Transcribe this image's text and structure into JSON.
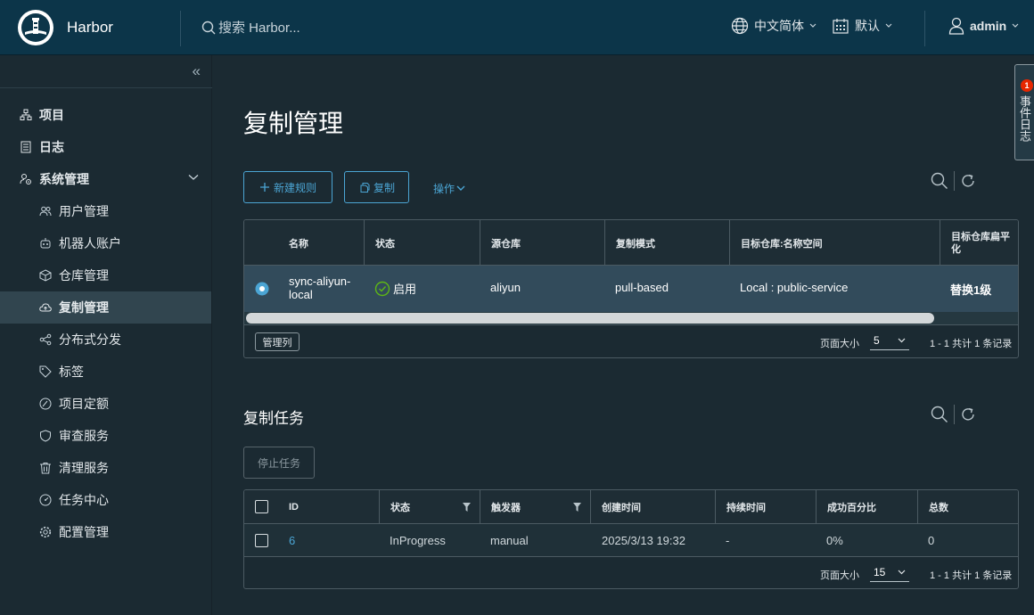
{
  "header": {
    "app_title": "Harbor",
    "search_placeholder": "搜索 Harbor...",
    "language": "中文简体",
    "date_format": "默认",
    "user": "admin"
  },
  "sidebar": {
    "items": [
      {
        "label": "项目"
      },
      {
        "label": "日志"
      },
      {
        "label": "系统管理"
      }
    ],
    "sub_items": [
      {
        "label": "用户管理"
      },
      {
        "label": "机器人账户"
      },
      {
        "label": "仓库管理"
      },
      {
        "label": "复制管理"
      },
      {
        "label": "分布式分发"
      },
      {
        "label": "标签"
      },
      {
        "label": "项目定额"
      },
      {
        "label": "审查服务"
      },
      {
        "label": "清理服务"
      },
      {
        "label": "任务中心"
      },
      {
        "label": "配置管理"
      }
    ],
    "active": "复制管理"
  },
  "main": {
    "title": "复制管理",
    "new_rule": "新建规则",
    "copy": "复制",
    "actions": "操作",
    "rules_table": {
      "columns": [
        "名称",
        "状态",
        "源仓库",
        "复制模式",
        "目标仓库:名称空间",
        "目标仓库扁平化"
      ],
      "rows": [
        {
          "name": "sync-aliyun-local",
          "status": "启用",
          "source": "aliyun",
          "mode": "pull-based",
          "dest": "Local : public-service",
          "flatten": "替换1级"
        }
      ],
      "manage_columns": "管理列",
      "page_size_label": "页面大小",
      "page_size": "5",
      "summary": "1 - 1 共计 1 条记录"
    },
    "tasks": {
      "title": "复制任务",
      "stop": "停止任务",
      "columns": [
        "ID",
        "状态",
        "触发器",
        "创建时间",
        "持续时间",
        "成功百分比",
        "总数"
      ],
      "rows": [
        {
          "id": "6",
          "status": "InProgress",
          "trigger": "manual",
          "created": "2025/3/13 19:32",
          "duration": "-",
          "percent": "0%",
          "total": "0"
        }
      ],
      "page_size_label": "页面大小",
      "page_size": "15",
      "summary": "1 - 1 共计 1 条记录"
    }
  },
  "event_log": {
    "label": "事件日志",
    "count": "1"
  },
  "colors": {
    "header_bg": "#0c3549",
    "body_bg": "#1b2a32",
    "accent": "#4ba5d4",
    "selected_row": "#324b5b",
    "success": "#5eb715",
    "badge": "#e62700"
  }
}
